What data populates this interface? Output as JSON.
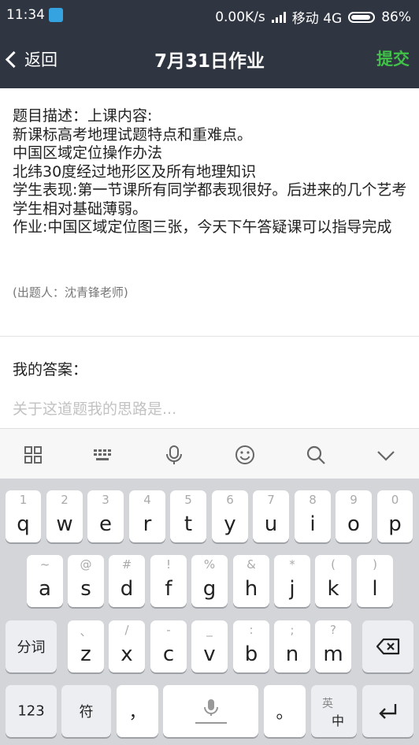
{
  "status_bar": {
    "time": "11:34",
    "speed": "0.00K/s",
    "carrier": "移动 4G",
    "battery": "86%"
  },
  "nav": {
    "back_label": "返回",
    "title": "7月31日作业",
    "submit_label": "提交"
  },
  "question": {
    "lines": [
      "题目描述：上课内容:",
      "新课标高考地理试题特点和重难点。",
      "中国区域定位操作办法",
      "北纬30度经过地形区及所有地理知识",
      "学生表现:第一节课所有同学都表现很好。后进来的几个艺考学生相对基础薄弱。",
      "作业:中国区域定位图三张，今天下午答疑课可以指导完成"
    ],
    "author": "(出题人：沈青锋老师)"
  },
  "answer": {
    "label": "我的答案：",
    "placeholder": "关于这道题我的思路是..."
  },
  "keyboard_toolbar": [
    "apps-grid-icon",
    "keyboard-icon",
    "microphone-icon",
    "emoji-icon",
    "search-icon",
    "collapse-icon"
  ],
  "keyboard": {
    "row1": [
      {
        "k": "q",
        "h": "1"
      },
      {
        "k": "w",
        "h": "2"
      },
      {
        "k": "e",
        "h": "3"
      },
      {
        "k": "r",
        "h": "4"
      },
      {
        "k": "t",
        "h": "5"
      },
      {
        "k": "y",
        "h": "6"
      },
      {
        "k": "u",
        "h": "7"
      },
      {
        "k": "i",
        "h": "8"
      },
      {
        "k": "o",
        "h": "9"
      },
      {
        "k": "p",
        "h": "0"
      }
    ],
    "row2": [
      {
        "k": "a",
        "h": "~"
      },
      {
        "k": "s",
        "h": "@"
      },
      {
        "k": "d",
        "h": "#"
      },
      {
        "k": "f",
        "h": "!"
      },
      {
        "k": "g",
        "h": "%"
      },
      {
        "k": "h",
        "h": "&"
      },
      {
        "k": "j",
        "h": "*"
      },
      {
        "k": "k",
        "h": "("
      },
      {
        "k": "l",
        "h": ")"
      }
    ],
    "row3": [
      {
        "k": "z",
        "h": "、"
      },
      {
        "k": "x",
        "h": "/"
      },
      {
        "k": "c",
        "h": "-"
      },
      {
        "k": "v",
        "h": "_"
      },
      {
        "k": "b",
        "h": ":"
      },
      {
        "k": "n",
        "h": ";"
      },
      {
        "k": "m",
        "h": "?"
      }
    ],
    "fenci": "分词",
    "num": "123",
    "fu": "符",
    "comma": "，",
    "period": "。",
    "lang_top": "英",
    "lang_bottom": "中"
  }
}
